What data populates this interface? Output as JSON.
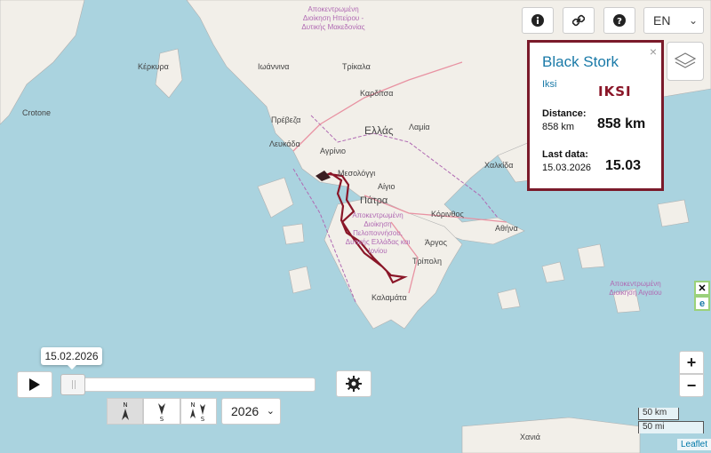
{
  "toolbar": {
    "info_icon": "info-icon",
    "link_icon": "link-icon",
    "help_icon": "help-icon",
    "language": "EN"
  },
  "popup": {
    "name": "Black Stork",
    "org": "Iksi",
    "logo_text": "IKSI",
    "distance_label": "Distance:",
    "distance_value": "858 km",
    "distance_big": "858 km",
    "last_data_label": "Last data:",
    "last_data_value": "15.03.2026",
    "last_data_big": "15.03",
    "close": "×"
  },
  "map_labels": {
    "epirus": "Αποκεντρωμένη Διοίκηση Ηπείρου - Δυτικής Μακεδονίας",
    "kerkyra": "Κέρκυρα",
    "crotone": "Crotone",
    "ioannina": "Ιωάννινα",
    "trikala": "Τρίκαλα",
    "karditsa": "Καρδίτσα",
    "lamia": "Λαμία",
    "preveza": "Πρέβεζα",
    "lefkada": "Λευκάδα",
    "ellas": "Ελλάς",
    "agrinio": "Αγρίνιο",
    "messolonghi": "Μεσολόγγι",
    "aigio": "Αίγιο",
    "patra": "Πάτρα",
    "chalkida": "Χαλκίδα",
    "korinthos": "Κόρινθος",
    "athina": "Αθήνα",
    "peloponnisos": "Αποκεντρωμένη Διοίκηση Πελοποννήσου, Δυτικής Ελλάδας και Ιονίου",
    "argos": "Άργος",
    "tripoli": "Τρίπολη",
    "kalamata": "Καλαμάτα",
    "aigaio": "Αποκεντρωμένη Διοίκηση Αιγαίου",
    "chania": "Χανιά"
  },
  "timeline": {
    "current_date": "15.02.2026",
    "progress": 0.0,
    "year": "2026"
  },
  "direction": {
    "north": "N",
    "south": "S"
  },
  "zoom": {
    "in": "+",
    "out": "−"
  },
  "scale": {
    "km": "50 km",
    "mi": "50 mi"
  },
  "attribution": "Leaflet",
  "colors": {
    "track": "#8a1628",
    "popup_border": "#7a1a2a",
    "accent": "#1a7aa8"
  }
}
